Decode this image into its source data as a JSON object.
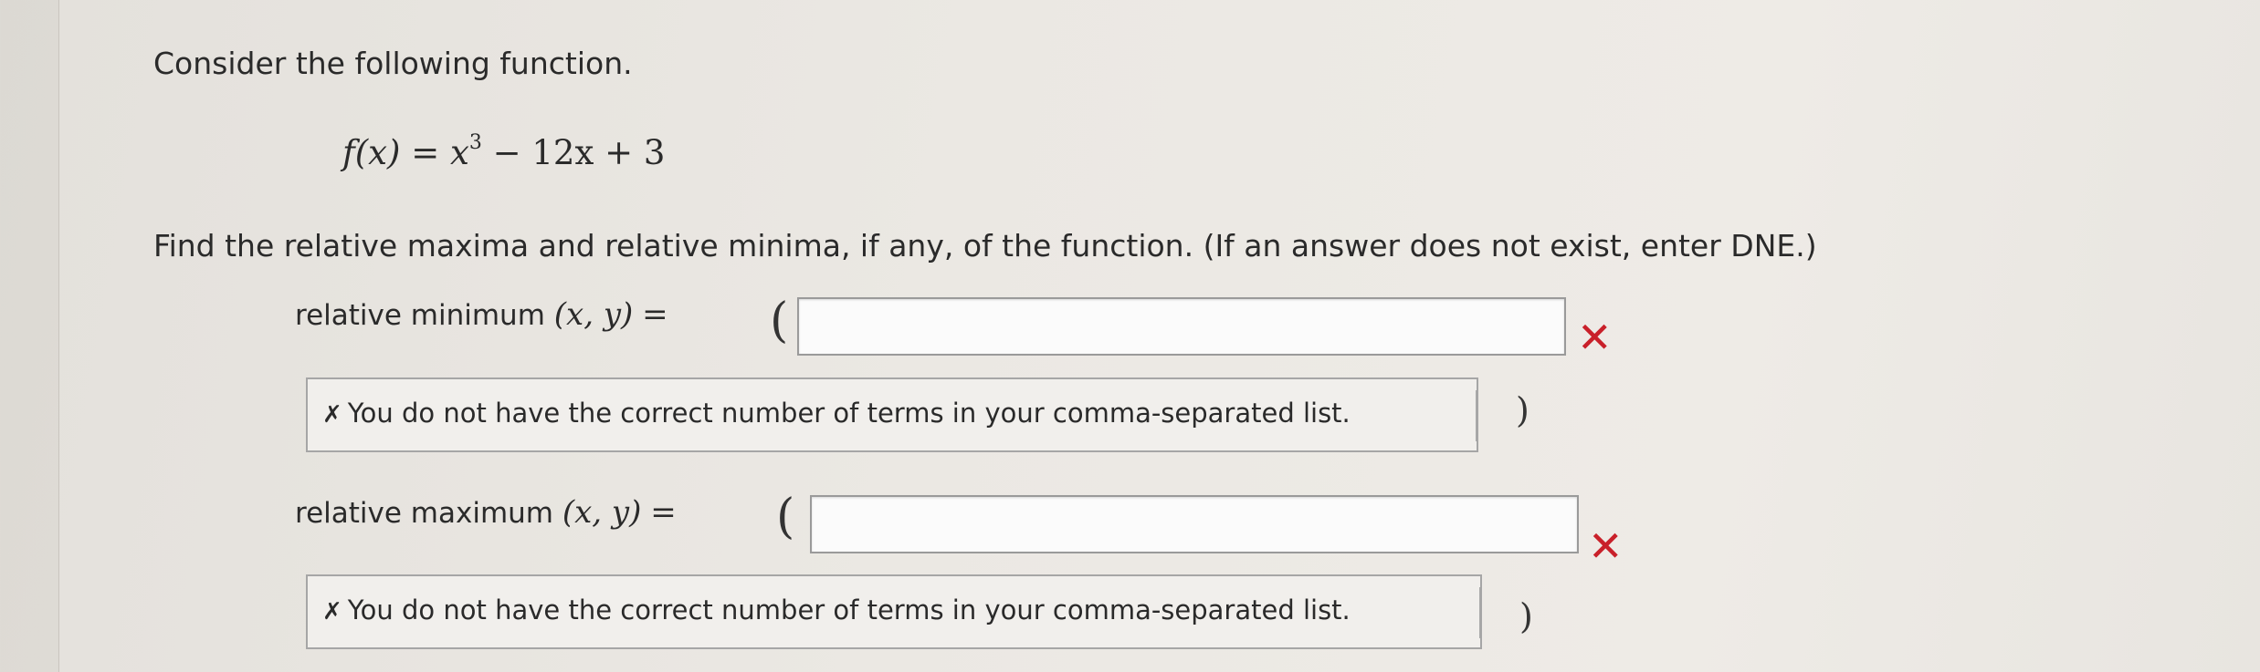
{
  "question": {
    "intro": "Consider the following function.",
    "formula": {
      "lhs": "f(x)",
      "equals": "=",
      "base": "x",
      "exponent": "3",
      "rest": "− 12x + 3"
    },
    "instruction": "Find the relative maxima and relative minima, if any, of the function. (If an answer does not exist, enter DNE.)"
  },
  "answers": {
    "minimum": {
      "label": "relative minimum",
      "vars": "(x, y)",
      "equals": "=",
      "open_paren": "(",
      "close_paren": ")",
      "value": "",
      "status_icon": "x-mark-icon",
      "status": "✕",
      "feedback_icon": "✗",
      "feedback": "You do not have the correct number of terms in your comma-separated list."
    },
    "maximum": {
      "label": "relative maximum",
      "vars": "(x, y)",
      "equals": "=",
      "open_paren": "(",
      "close_paren": ")",
      "value": "",
      "status_icon": "x-mark-icon",
      "status": "✕",
      "feedback_icon": "✗",
      "feedback": "You do not have the correct number of terms in your comma-separated list."
    }
  },
  "colors": {
    "error": "#c9202a",
    "page_background": "#ebe8e3",
    "feedback_background": "#f1efec"
  }
}
